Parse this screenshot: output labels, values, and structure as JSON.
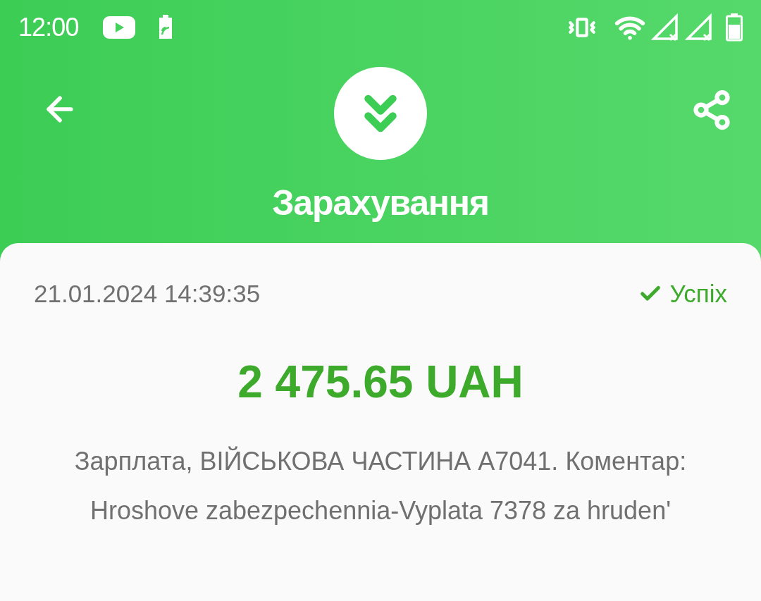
{
  "status_bar": {
    "time": "12:00"
  },
  "header": {
    "title": "Зарахування"
  },
  "transaction": {
    "datetime": "21.01.2024 14:39:35",
    "status": "Успіх",
    "success": true,
    "amount": "2 475.65 UAH",
    "description": "Зарплата, ВІЙСЬКОВА ЧАСТИНА А7041. Коментар: Hroshove zabezpechennia-Vyplata 7378 za hruden'"
  }
}
